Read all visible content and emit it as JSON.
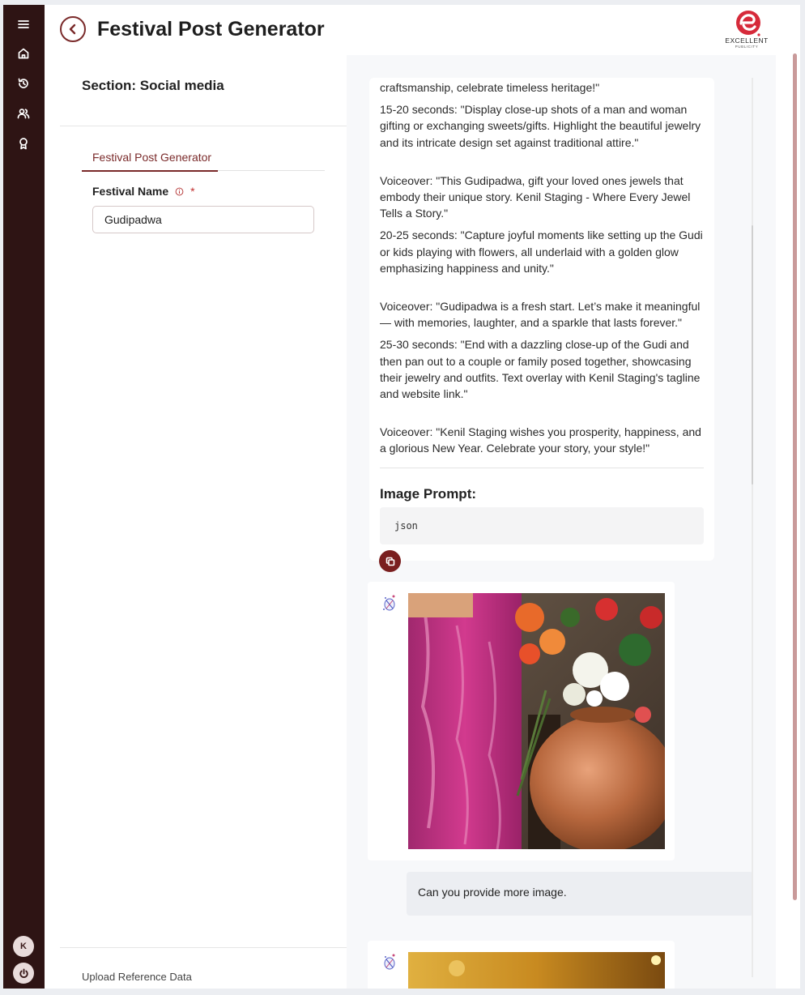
{
  "header": {
    "title": "Festival Post Generator",
    "logo_text": "EXCELLENT",
    "logo_subtext": "PUBLICITY"
  },
  "sidebar": {
    "items": [
      {
        "icon": "menu-icon"
      },
      {
        "icon": "home-icon"
      },
      {
        "icon": "history-icon"
      },
      {
        "icon": "users-icon"
      },
      {
        "icon": "award-icon"
      }
    ],
    "avatar_initial": "K"
  },
  "left_panel": {
    "section_title": "Section: Social media",
    "tab_label": "Festival Post Generator",
    "field_label": "Festival Name",
    "required_mark": "*",
    "field_value": "Gudipadwa",
    "bottom_text": "Upload Reference Data"
  },
  "right_panel": {
    "paragraphs": [
      "craftsmanship, celebrate timeless heritage!\"",
      "15-20 seconds: \"Display close-up shots of a man and woman gifting or exchanging sweets/gifts. Highlight the beautiful jewelry and its intricate design set against traditional attire.\"",
      "Voiceover: \"This Gudipadwa, gift your loved ones jewels that embody their unique story. Kenil Staging - Where Every Jewel Tells a Story.\"",
      "20-25 seconds: \"Capture joyful moments like setting up the Gudi or kids playing with flowers, all underlaid with a golden glow emphasizing happiness and unity.\"",
      "Voiceover: \"Gudipadwa is a fresh start. Let’s make it meaningful — with memories, laughter, and a sparkle that lasts forever.\"",
      "25-30 seconds: \"End with a dazzling close-up of the Gudi and then pan out to a couple or family posed together, showcasing their jewelry and outfits. Text overlay with Kenil Staging's tagline and website link.\"",
      "Voiceover: \"Kenil Staging wishes you prosperity, happiness, and a glorious New Year. Celebrate your story, your style!\""
    ],
    "image_prompt_title": "Image Prompt:",
    "code_text": "json",
    "user_message": "Can you provide more image."
  },
  "colors": {
    "sidebar_bg": "#2e1414",
    "accent": "#7a2a2a",
    "panel_bg": "#f7f8fa"
  }
}
